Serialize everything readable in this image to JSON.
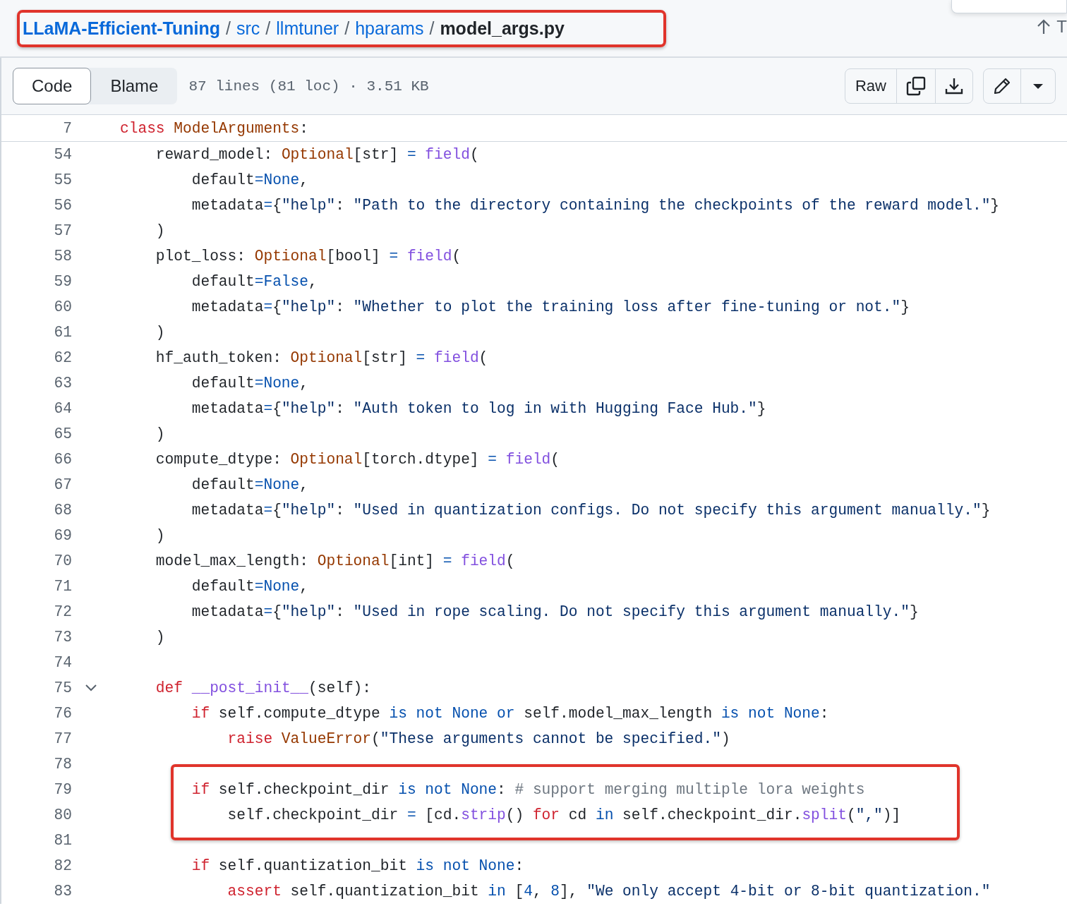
{
  "breadcrumb": {
    "highlighted": true,
    "items": [
      {
        "label": "LLaMA-Efficient-Tuning",
        "kind": "repo"
      },
      {
        "label": "src",
        "kind": "dir"
      },
      {
        "label": "llmtuner",
        "kind": "dir"
      },
      {
        "label": "hparams",
        "kind": "dir"
      },
      {
        "label": "model_args.py",
        "kind": "file"
      }
    ],
    "separator": "/"
  },
  "top_button": {
    "label": "T"
  },
  "view_tabs": [
    {
      "label": "Code",
      "selected": true
    },
    {
      "label": "Blame",
      "selected": false
    }
  ],
  "file_info": "87 lines (81 loc) · 3.51 KB",
  "raw_button": "Raw",
  "sticky_line": {
    "n": "7",
    "tokens": [
      {
        "kind": "keyword",
        "text": "class"
      },
      {
        "kind": "type",
        "text": " ModelArguments"
      },
      {
        "kind": "plain",
        "text": ":"
      }
    ]
  },
  "lines": [
    {
      "n": "54",
      "tokens": [
        {
          "kind": "plain",
          "text": "    reward_model: "
        },
        {
          "kind": "type",
          "text": "Optional"
        },
        {
          "kind": "plain",
          "text": "[str] "
        },
        {
          "kind": "constant",
          "text": "="
        },
        {
          "kind": "function",
          "text": " field"
        },
        {
          "kind": "plain",
          "text": "("
        }
      ]
    },
    {
      "n": "55",
      "tokens": [
        {
          "kind": "plain",
          "text": "        default"
        },
        {
          "kind": "constant",
          "text": "=None"
        },
        {
          "kind": "plain",
          "text": ","
        }
      ]
    },
    {
      "n": "56",
      "tokens": [
        {
          "kind": "plain",
          "text": "        metadata"
        },
        {
          "kind": "constant",
          "text": "="
        },
        {
          "kind": "plain",
          "text": "{"
        },
        {
          "kind": "string",
          "text": "\"help\""
        },
        {
          "kind": "plain",
          "text": ": "
        },
        {
          "kind": "string",
          "text": "\"Path to the directory containing the checkpoints of the reward model.\""
        },
        {
          "kind": "plain",
          "text": "}"
        }
      ]
    },
    {
      "n": "57",
      "tokens": [
        {
          "kind": "plain",
          "text": "    )"
        }
      ]
    },
    {
      "n": "58",
      "tokens": [
        {
          "kind": "plain",
          "text": "    plot_loss: "
        },
        {
          "kind": "type",
          "text": "Optional"
        },
        {
          "kind": "plain",
          "text": "[bool] "
        },
        {
          "kind": "constant",
          "text": "="
        },
        {
          "kind": "function",
          "text": " field"
        },
        {
          "kind": "plain",
          "text": "("
        }
      ]
    },
    {
      "n": "59",
      "tokens": [
        {
          "kind": "plain",
          "text": "        default"
        },
        {
          "kind": "constant",
          "text": "=False"
        },
        {
          "kind": "plain",
          "text": ","
        }
      ]
    },
    {
      "n": "60",
      "tokens": [
        {
          "kind": "plain",
          "text": "        metadata"
        },
        {
          "kind": "constant",
          "text": "="
        },
        {
          "kind": "plain",
          "text": "{"
        },
        {
          "kind": "string",
          "text": "\"help\""
        },
        {
          "kind": "plain",
          "text": ": "
        },
        {
          "kind": "string",
          "text": "\"Whether to plot the training loss after fine-tuning or not.\""
        },
        {
          "kind": "plain",
          "text": "}"
        }
      ]
    },
    {
      "n": "61",
      "tokens": [
        {
          "kind": "plain",
          "text": "    )"
        }
      ]
    },
    {
      "n": "62",
      "tokens": [
        {
          "kind": "plain",
          "text": "    hf_auth_token: "
        },
        {
          "kind": "type",
          "text": "Optional"
        },
        {
          "kind": "plain",
          "text": "[str] "
        },
        {
          "kind": "constant",
          "text": "="
        },
        {
          "kind": "function",
          "text": " field"
        },
        {
          "kind": "plain",
          "text": "("
        }
      ]
    },
    {
      "n": "63",
      "tokens": [
        {
          "kind": "plain",
          "text": "        default"
        },
        {
          "kind": "constant",
          "text": "=None"
        },
        {
          "kind": "plain",
          "text": ","
        }
      ]
    },
    {
      "n": "64",
      "tokens": [
        {
          "kind": "plain",
          "text": "        metadata"
        },
        {
          "kind": "constant",
          "text": "="
        },
        {
          "kind": "plain",
          "text": "{"
        },
        {
          "kind": "string",
          "text": "\"help\""
        },
        {
          "kind": "plain",
          "text": ": "
        },
        {
          "kind": "string",
          "text": "\"Auth token to log in with Hugging Face Hub.\""
        },
        {
          "kind": "plain",
          "text": "}"
        }
      ]
    },
    {
      "n": "65",
      "tokens": [
        {
          "kind": "plain",
          "text": "    )"
        }
      ]
    },
    {
      "n": "66",
      "tokens": [
        {
          "kind": "plain",
          "text": "    compute_dtype: "
        },
        {
          "kind": "type",
          "text": "Optional"
        },
        {
          "kind": "plain",
          "text": "[torch.dtype] "
        },
        {
          "kind": "constant",
          "text": "="
        },
        {
          "kind": "function",
          "text": " field"
        },
        {
          "kind": "plain",
          "text": "("
        }
      ]
    },
    {
      "n": "67",
      "tokens": [
        {
          "kind": "plain",
          "text": "        default"
        },
        {
          "kind": "constant",
          "text": "=None"
        },
        {
          "kind": "plain",
          "text": ","
        }
      ]
    },
    {
      "n": "68",
      "tokens": [
        {
          "kind": "plain",
          "text": "        metadata"
        },
        {
          "kind": "constant",
          "text": "="
        },
        {
          "kind": "plain",
          "text": "{"
        },
        {
          "kind": "string",
          "text": "\"help\""
        },
        {
          "kind": "plain",
          "text": ": "
        },
        {
          "kind": "string",
          "text": "\"Used in quantization configs. Do not specify this argument manually.\""
        },
        {
          "kind": "plain",
          "text": "}"
        }
      ]
    },
    {
      "n": "69",
      "tokens": [
        {
          "kind": "plain",
          "text": "    )"
        }
      ]
    },
    {
      "n": "70",
      "tokens": [
        {
          "kind": "plain",
          "text": "    model_max_length: "
        },
        {
          "kind": "type",
          "text": "Optional"
        },
        {
          "kind": "plain",
          "text": "[int] "
        },
        {
          "kind": "constant",
          "text": "="
        },
        {
          "kind": "function",
          "text": " field"
        },
        {
          "kind": "plain",
          "text": "("
        }
      ]
    },
    {
      "n": "71",
      "tokens": [
        {
          "kind": "plain",
          "text": "        default"
        },
        {
          "kind": "constant",
          "text": "=None"
        },
        {
          "kind": "plain",
          "text": ","
        }
      ]
    },
    {
      "n": "72",
      "tokens": [
        {
          "kind": "plain",
          "text": "        metadata"
        },
        {
          "kind": "constant",
          "text": "="
        },
        {
          "kind": "plain",
          "text": "{"
        },
        {
          "kind": "string",
          "text": "\"help\""
        },
        {
          "kind": "plain",
          "text": ": "
        },
        {
          "kind": "string",
          "text": "\"Used in rope scaling. Do not specify this argument manually.\""
        },
        {
          "kind": "plain",
          "text": "}"
        }
      ]
    },
    {
      "n": "73",
      "tokens": [
        {
          "kind": "plain",
          "text": "    )"
        }
      ]
    },
    {
      "n": "74"
    },
    {
      "n": "75",
      "expanded": true,
      "tokens": [
        {
          "kind": "keyword",
          "text": "    def"
        },
        {
          "kind": "function",
          "text": " __post_init__"
        },
        {
          "kind": "plain",
          "text": "(self):"
        }
      ]
    },
    {
      "n": "76",
      "tokens": [
        {
          "kind": "keyword",
          "text": "        if"
        },
        {
          "kind": "plain",
          "text": " self.compute_dtype "
        },
        {
          "kind": "constant",
          "text": "is not None or"
        },
        {
          "kind": "plain",
          "text": " self.model_max_length "
        },
        {
          "kind": "constant",
          "text": "is not None"
        },
        {
          "kind": "plain",
          "text": ":"
        }
      ]
    },
    {
      "n": "77",
      "tokens": [
        {
          "kind": "keyword",
          "text": "            raise"
        },
        {
          "kind": "type",
          "text": " ValueError"
        },
        {
          "kind": "plain",
          "text": "("
        },
        {
          "kind": "string",
          "text": "\"These arguments cannot be specified.\""
        },
        {
          "kind": "plain",
          "text": ")"
        }
      ]
    },
    {
      "n": "78"
    },
    {
      "n": "79",
      "highlight": true,
      "tokens": [
        {
          "kind": "keyword",
          "text": "        if"
        },
        {
          "kind": "plain",
          "text": " self.checkpoint_dir "
        },
        {
          "kind": "constant",
          "text": "is not None"
        },
        {
          "kind": "plain",
          "text": ":"
        },
        {
          "kind": "comment",
          "text": " # support merging multiple lora weights"
        }
      ]
    },
    {
      "n": "80",
      "highlight": true,
      "tokens": [
        {
          "kind": "plain",
          "text": "            self.checkpoint_dir "
        },
        {
          "kind": "constant",
          "text": "="
        },
        {
          "kind": "plain",
          "text": " [cd."
        },
        {
          "kind": "function",
          "text": "strip"
        },
        {
          "kind": "plain",
          "text": "() "
        },
        {
          "kind": "keyword",
          "text": "for"
        },
        {
          "kind": "plain",
          "text": " cd "
        },
        {
          "kind": "constant",
          "text": "in"
        },
        {
          "kind": "plain",
          "text": " self.checkpoint_dir."
        },
        {
          "kind": "function",
          "text": "split"
        },
        {
          "kind": "plain",
          "text": "("
        },
        {
          "kind": "string",
          "text": "\",\""
        },
        {
          "kind": "plain",
          "text": ")]"
        }
      ]
    },
    {
      "n": "81"
    },
    {
      "n": "82",
      "tokens": [
        {
          "kind": "keyword",
          "text": "        if"
        },
        {
          "kind": "plain",
          "text": " self.quantization_bit "
        },
        {
          "kind": "constant",
          "text": "is not None"
        },
        {
          "kind": "plain",
          "text": ":"
        }
      ]
    },
    {
      "n": "83",
      "tokens": [
        {
          "kind": "keyword",
          "text": "            assert"
        },
        {
          "kind": "plain",
          "text": " self.quantization_bit "
        },
        {
          "kind": "constant",
          "text": "in"
        },
        {
          "kind": "plain",
          "text": " ["
        },
        {
          "kind": "constant",
          "text": "4"
        },
        {
          "kind": "plain",
          "text": ", "
        },
        {
          "kind": "constant",
          "text": "8"
        },
        {
          "kind": "plain",
          "text": "], "
        },
        {
          "kind": "string",
          "text": "\"We only accept 4-bit or 8-bit quantization.\""
        }
      ]
    }
  ]
}
